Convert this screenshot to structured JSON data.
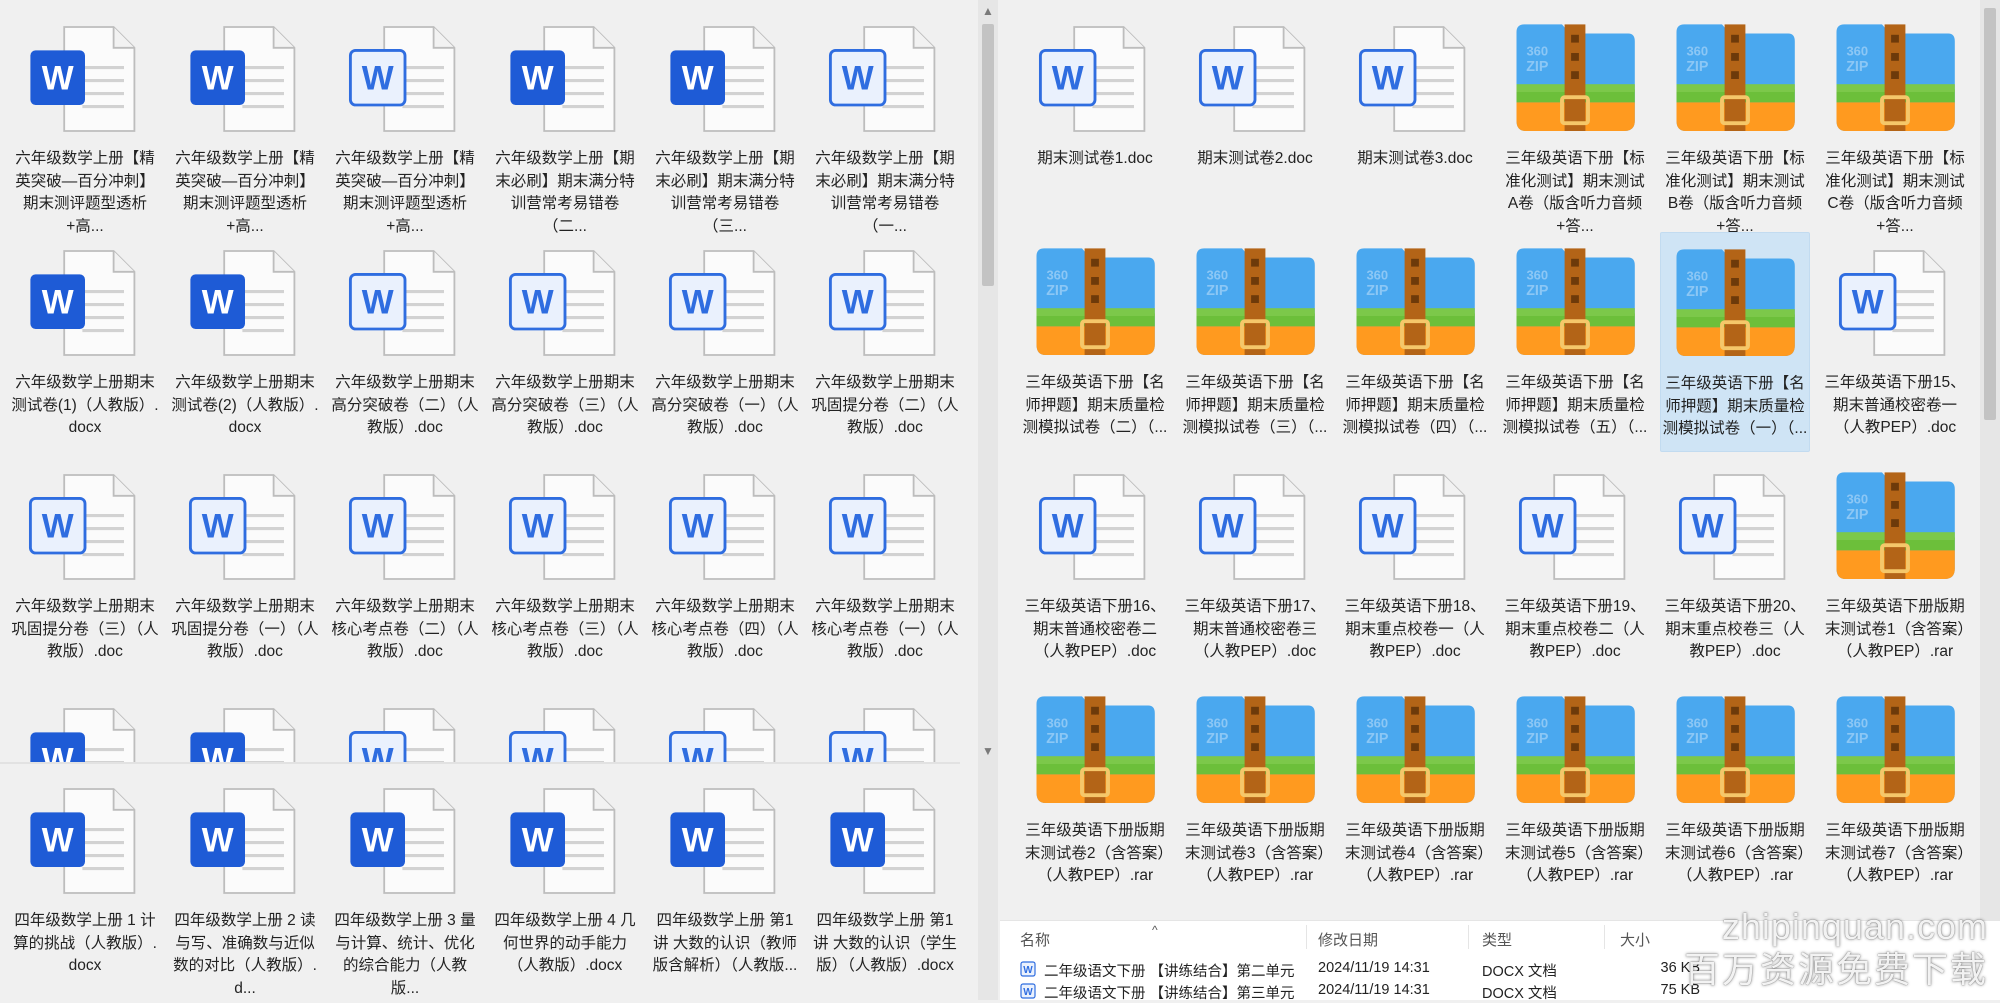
{
  "left_pane": {
    "rows": [
      [
        {
          "label": "六年级数学上册【精英突破—百分冲刺】期末测评题型透析+高...",
          "icon": "word-icon-bold"
        },
        {
          "label": "六年级数学上册【精英突破—百分冲刺】期末测评题型透析+高...",
          "icon": "word-icon-bold"
        },
        {
          "label": "六年级数学上册【精英突破—百分冲刺】期末测评题型透析+高...",
          "icon": "word-icon-light"
        },
        {
          "label": "六年级数学上册【期末必刷】期末满分特训营常考易错卷（二...",
          "icon": "word-icon-bold"
        },
        {
          "label": "六年级数学上册【期末必刷】期末满分特训营常考易错卷（三...",
          "icon": "word-icon-bold"
        },
        {
          "label": "六年级数学上册【期末必刷】期末满分特训营常考易错卷（一...",
          "icon": "word-icon-light"
        }
      ],
      [
        {
          "label": "六年级数学上册期末测试卷(1)（人教版）.docx",
          "icon": "word-icon-bold"
        },
        {
          "label": "六年级数学上册期末测试卷(2)（人教版）.docx",
          "icon": "word-icon-bold"
        },
        {
          "label": "六年级数学上册期末高分突破卷（二）（人教版）.doc",
          "icon": "word-icon-light"
        },
        {
          "label": "六年级数学上册期末高分突破卷（三）（人教版）.doc",
          "icon": "word-icon-light"
        },
        {
          "label": "六年级数学上册期末高分突破卷（一）（人教版）.doc",
          "icon": "word-icon-light"
        },
        {
          "label": "六年级数学上册期末巩固提分卷（二）（人教版）.doc",
          "icon": "word-icon-light"
        }
      ],
      [
        {
          "label": "六年级数学上册期末巩固提分卷（三）（人教版）.doc",
          "icon": "word-icon-light"
        },
        {
          "label": "六年级数学上册期末巩固提分卷（一）（人教版）.doc",
          "icon": "word-icon-light"
        },
        {
          "label": "六年级数学上册期末核心考点卷（二）（人教版）.doc",
          "icon": "word-icon-light"
        },
        {
          "label": "六年级数学上册期末核心考点卷（三）（人教版）.doc",
          "icon": "word-icon-light"
        },
        {
          "label": "六年级数学上册期末核心考点卷（四）（人教版）.doc",
          "icon": "word-icon-light"
        },
        {
          "label": "六年级数学上册期末核心考点卷（一）（人教版）.doc",
          "icon": "word-icon-light"
        }
      ]
    ],
    "partial_row_icons": [
      "word-icon-bold",
      "word-icon-bold",
      "word-icon-light",
      "word-icon-light",
      "word-icon-light",
      "word-icon-light"
    ],
    "bottom_rows": [
      [
        {
          "label": "四年级数学上册 1 计算的挑战（人教版）.docx",
          "icon": "word-icon-bold"
        },
        {
          "label": "四年级数学上册 2 读与写、准确数与近似数的对比（人教版）.d...",
          "icon": "word-icon-bold"
        },
        {
          "label": "四年级数学上册 3 量与计算、统计、优化的综合能力（人教版...",
          "icon": "word-icon-bold"
        },
        {
          "label": "四年级数学上册 4 几何世界的动手能力（人教版）.docx",
          "icon": "word-icon-bold"
        },
        {
          "label": "四年级数学上册 第1讲 大数的认识（教师版含解析）（人教版...",
          "icon": "word-icon-bold"
        },
        {
          "label": "四年级数学上册 第1讲 大数的认识（学生版）（人教版）.docx",
          "icon": "word-icon-bold"
        }
      ]
    ]
  },
  "right_pane": {
    "rows": [
      [
        {
          "label": "期末测试卷1.doc",
          "icon": "word-icon-light"
        },
        {
          "label": "期末测试卷2.doc",
          "icon": "word-icon-light"
        },
        {
          "label": "期末测试卷3.doc",
          "icon": "word-icon-light"
        },
        {
          "label": "三年级英语下册【标准化测试】期末测试A卷（版含听力音频+答...",
          "icon": "zip-icon"
        },
        {
          "label": "三年级英语下册【标准化测试】期末测试B卷（版含听力音频+答...",
          "icon": "zip-icon"
        },
        {
          "label": "三年级英语下册【标准化测试】期末测试C卷（版含听力音频+答...",
          "icon": "zip-icon"
        }
      ],
      [
        {
          "label": "三年级英语下册【名师押题】期末质量检测模拟试卷（二）（...",
          "icon": "zip-icon"
        },
        {
          "label": "三年级英语下册【名师押题】期末质量检测模拟试卷（三）（...",
          "icon": "zip-icon"
        },
        {
          "label": "三年级英语下册【名师押题】期末质量检测模拟试卷（四）（...",
          "icon": "zip-icon"
        },
        {
          "label": "三年级英语下册【名师押题】期末质量检测模拟试卷（五）（...",
          "icon": "zip-icon"
        },
        {
          "label": "三年级英语下册【名师押题】期末质量检测模拟试卷（一）（...",
          "icon": "zip-icon",
          "selected": true
        },
        {
          "label": "三年级英语下册15、期末普通校密卷一（人教PEP）.doc",
          "icon": "word-icon-light"
        }
      ],
      [
        {
          "label": "三年级英语下册16、期末普通校密卷二（人教PEP）.doc",
          "icon": "word-icon-light"
        },
        {
          "label": "三年级英语下册17、期末普通校密卷三（人教PEP）.doc",
          "icon": "word-icon-light"
        },
        {
          "label": "三年级英语下册18、期末重点校卷一（人教PEP）.doc",
          "icon": "word-icon-light"
        },
        {
          "label": "三年级英语下册19、期末重点校卷二（人教PEP）.doc",
          "icon": "word-icon-light"
        },
        {
          "label": "三年级英语下册20、期末重点校卷三（人教PEP）.doc",
          "icon": "word-icon-light"
        },
        {
          "label": "三年级英语下册版期末测试卷1（含答案）（人教PEP）.rar",
          "icon": "zip-icon"
        }
      ],
      [
        {
          "label": "三年级英语下册版期末测试卷2（含答案）（人教PEP）.rar",
          "icon": "zip-icon"
        },
        {
          "label": "三年级英语下册版期末测试卷3（含答案）（人教PEP）.rar",
          "icon": "zip-icon"
        },
        {
          "label": "三年级英语下册版期末测试卷4（含答案）（人教PEP）.rar",
          "icon": "zip-icon"
        },
        {
          "label": "三年级英语下册版期末测试卷5（含答案）（人教PEP）.rar",
          "icon": "zip-icon"
        },
        {
          "label": "三年级英语下册版期末测试卷6（含答案）（人教PEP）.rar",
          "icon": "zip-icon"
        },
        {
          "label": "三年级英语下册版期末测试卷7（含答案）（人教PEP）.rar",
          "icon": "zip-icon"
        }
      ]
    ]
  },
  "details": {
    "headers": {
      "name": "名称",
      "modified": "修改日期",
      "type": "类型",
      "size": "大小"
    },
    "rows": [
      {
        "name": "二年级语文下册 【讲练结合】第二单元...",
        "modified": "2024/11/19 14:31",
        "type": "DOCX 文档",
        "size": "36 KB"
      },
      {
        "name": "二年级语文下册 【讲练结合】第三单元...",
        "modified": "2024/11/19 14:31",
        "type": "DOCX 文档",
        "size": "75 KB"
      }
    ]
  },
  "watermark": {
    "line1": "zhipinquan.com",
    "line2": "百万资源免费下载"
  },
  "colors": {
    "word_bold": "#1e5bd6",
    "word_light_border": "#2f6de0",
    "zip_blue": "#4aa8ef",
    "zip_orange": "#ff9a1f",
    "zip_green": "#6cbf3a",
    "zip_strap": "#b36417"
  }
}
